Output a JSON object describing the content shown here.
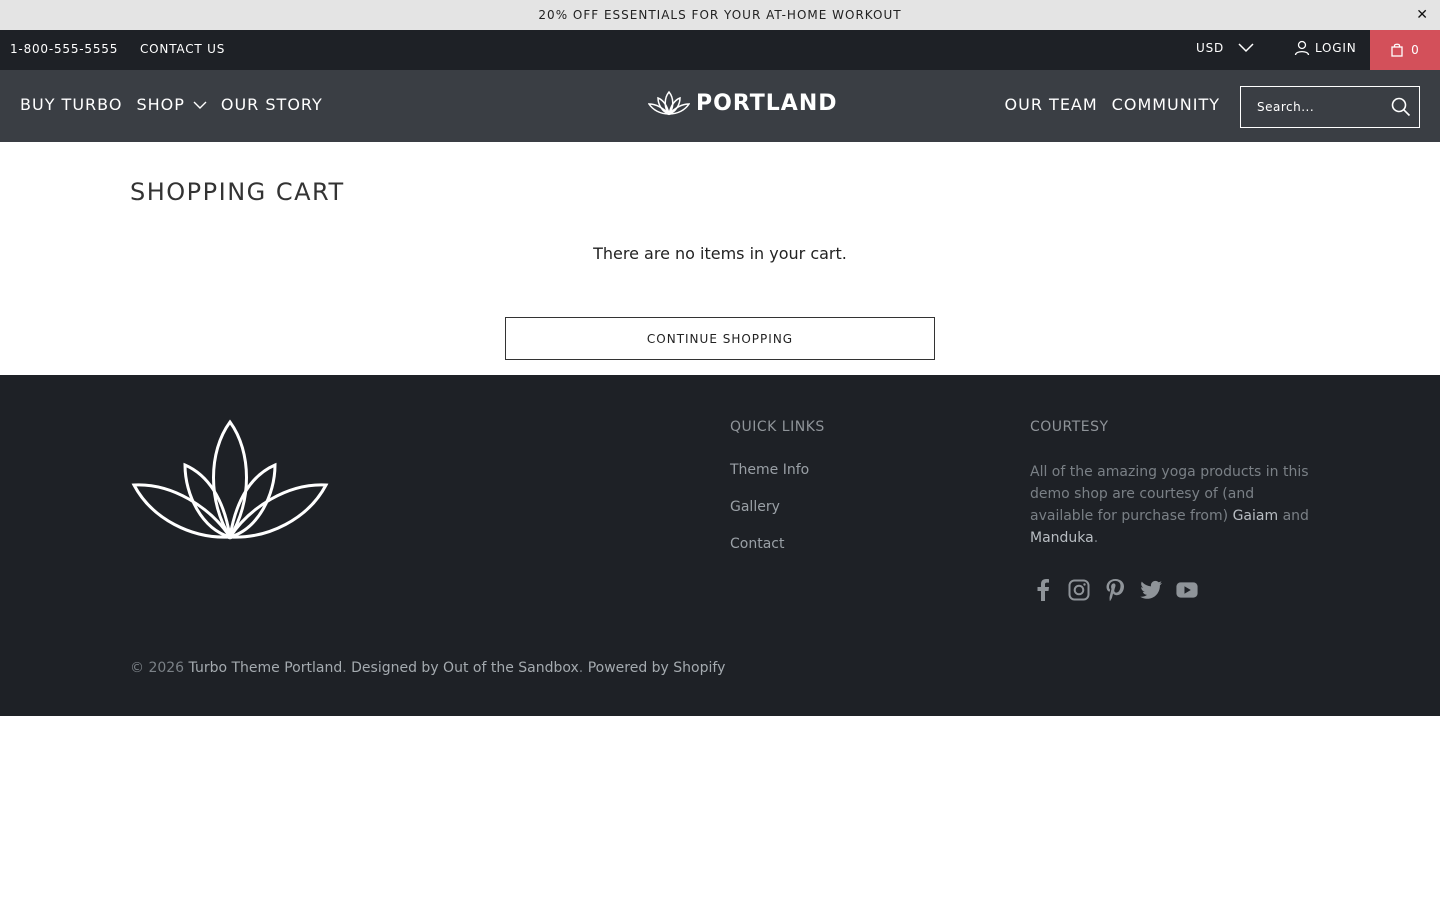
{
  "announcement": {
    "text": "20% OFF ESSENTIALS FOR YOUR AT-HOME WORKOUT",
    "close": "✕"
  },
  "topbar": {
    "phone": "1-800-555-5555",
    "contact": "CONTACT US",
    "currency": "USD",
    "login": "LOGIN",
    "cart_count": "0",
    "cart_color": "#d3505a"
  },
  "header": {
    "nav_left": [
      "BUY TURBO",
      "SHOP",
      "OUR STORY"
    ],
    "nav_right": [
      "OUR TEAM",
      "COMMUNITY"
    ],
    "logo_text": "PORTLAND",
    "search_placeholder": "Search..."
  },
  "main": {
    "title": "SHOPPING CART",
    "empty_message": "There are no items in your cart.",
    "continue_label": "CONTINUE SHOPPING"
  },
  "footer": {
    "quick_links_title": "QUICK LINKS",
    "quick_links": [
      "Theme Info",
      "Gallery",
      "Contact"
    ],
    "courtesy_title": "COURTESY",
    "courtesy_text": "All of the amazing yoga products in this demo shop are courtesy of (and available for purchase from)",
    "courtesy_link1": "Gaiam",
    "courtesy_and": "and",
    "courtesy_link2": "Manduka",
    "courtesy_end": ".",
    "socials": [
      "facebook-icon",
      "instagram-icon",
      "pinterest-icon",
      "twitter-icon",
      "youtube-icon"
    ],
    "copyright_prefix": "© 2026",
    "copyright_link": "Turbo Theme Portland",
    "designed_by": "Designed by Out of the Sandbox",
    "powered_by": "Powered by Shopify"
  }
}
